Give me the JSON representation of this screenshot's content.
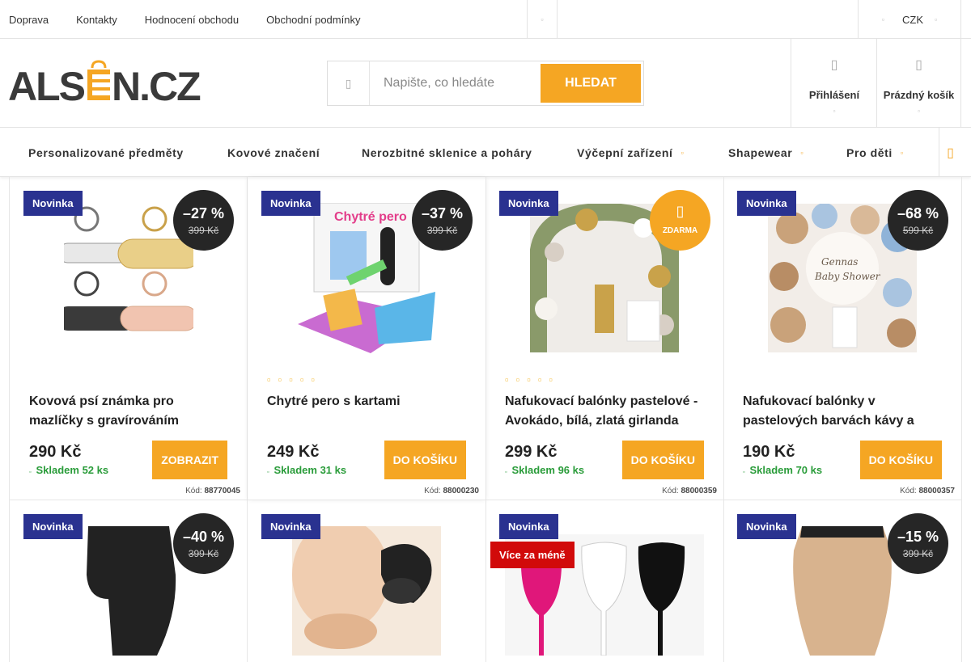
{
  "topbar": {
    "links": [
      "Doprava",
      "Kontakty",
      "Hodnocení obchodu",
      "Obchodní podmínky"
    ],
    "currency": "CZK"
  },
  "header": {
    "logo_text": "ALSEN.CZ",
    "search_placeholder": "Napište, co hledáte",
    "search_button": "HLEDAT",
    "login_label": "Přihlášení",
    "cart_label": "Prázdný košík"
  },
  "nav": {
    "items": [
      {
        "label": "Personalizované předměty",
        "has_submenu": false
      },
      {
        "label": "Kovové značení",
        "has_submenu": false
      },
      {
        "label": "Nerozbitné sklenice a poháry",
        "has_submenu": false
      },
      {
        "label": "Výčepní zařízení",
        "has_submenu": true
      },
      {
        "label": "Shapewear",
        "has_submenu": true
      },
      {
        "label": "Pro děti",
        "has_submenu": true
      }
    ]
  },
  "products": [
    {
      "badge": "Novinka",
      "discount": "–27 %",
      "old_price": "399 Kč",
      "name": "Kovová psí známka pro mazlíčky s gravírováním",
      "price": "290 Kč",
      "stock": "Skladem 52 ks",
      "button": "ZOBRAZIT",
      "code_label": "Kód:",
      "code": "88770045",
      "stars": false
    },
    {
      "badge": "Novinka",
      "discount": "–37 %",
      "old_price": "399 Kč",
      "name": "Chytré pero s kartami",
      "price": "249 Kč",
      "stock": "Skladem 31 ks",
      "button": "DO KOŠÍKU",
      "code_label": "Kód:",
      "code": "88000230",
      "stars": true
    },
    {
      "badge": "Novinka",
      "free_label": "ZDARMA",
      "name": "Nafukovací balónky pastelové - Avokádo, bílá, zlatá girlanda",
      "price": "299 Kč",
      "stock": "Skladem 96 ks",
      "button": "DO KOŠÍKU",
      "code_label": "Kód:",
      "code": "88000359",
      "stars": true
    },
    {
      "badge": "Novinka",
      "discount": "–68 %",
      "old_price": "599 Kč",
      "name": "Nafukovací balónky v pastelových barvách kávy a",
      "price": "190 Kč",
      "stock": "Skladem 70 ks",
      "button": "DO KOŠÍKU",
      "code_label": "Kód:",
      "code": "88000357",
      "stars": false
    },
    {
      "badge": "Novinka",
      "discount": "–40 %",
      "old_price": "399 Kč"
    },
    {
      "badge": "Novinka"
    },
    {
      "badge": "Novinka",
      "badge2": "Více za méně"
    },
    {
      "badge": "Novinka",
      "discount": "–15 %",
      "old_price": "399 Kč"
    }
  ],
  "colors": {
    "accent": "#f5a623",
    "badge_blue": "#2a3290",
    "badge_red": "#d10a0a",
    "stock_green": "#2a9c3a"
  }
}
